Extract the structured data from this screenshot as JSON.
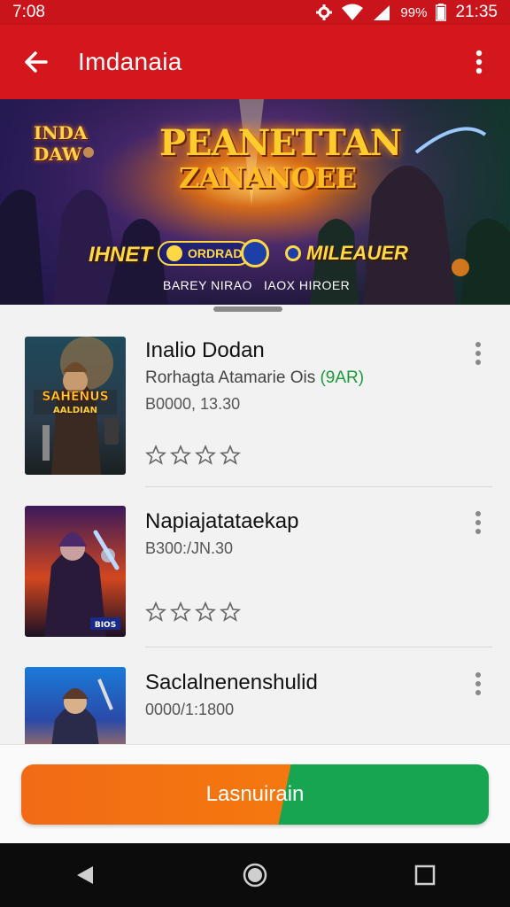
{
  "status_bar": {
    "time": "7:08",
    "battery_percent": "99%",
    "clock": "21:35"
  },
  "app_bar": {
    "title": "Imdanaia",
    "back_icon": "arrow-left-icon",
    "menu_icon": "more-vert-icon"
  },
  "banner": {
    "logo_text": "INDA DAW",
    "title_line1": "PEANETTAN",
    "title_line2": "ZANANOEE",
    "pill_left": "IHNET",
    "pill_mid": "ORDRAD",
    "pill_right": "MILEAUER",
    "sub_left": "BAREY NIRAO",
    "sub_right": "IAOX HIROER"
  },
  "list": {
    "items": [
      {
        "title": "Inalio Dodan",
        "subtitle": "Rorhagta Atamarie Ois",
        "subtitle_accent": "(9AR)",
        "meta": "B0000, 13.30",
        "rating": 0
      },
      {
        "title": "Napiajatataekap",
        "subtitle": "",
        "subtitle_accent": "",
        "meta": "B300:/JN.30",
        "rating": 0
      },
      {
        "title": "Saclalnenenshulid",
        "subtitle": "",
        "subtitle_accent": "",
        "meta": "0000/1:1800",
        "rating": 0
      }
    ]
  },
  "cta": {
    "label": "Lasnuirain"
  },
  "colors": {
    "primary": "#d3171d",
    "cta_orange": "#f26a16",
    "cta_green": "#17a552"
  }
}
